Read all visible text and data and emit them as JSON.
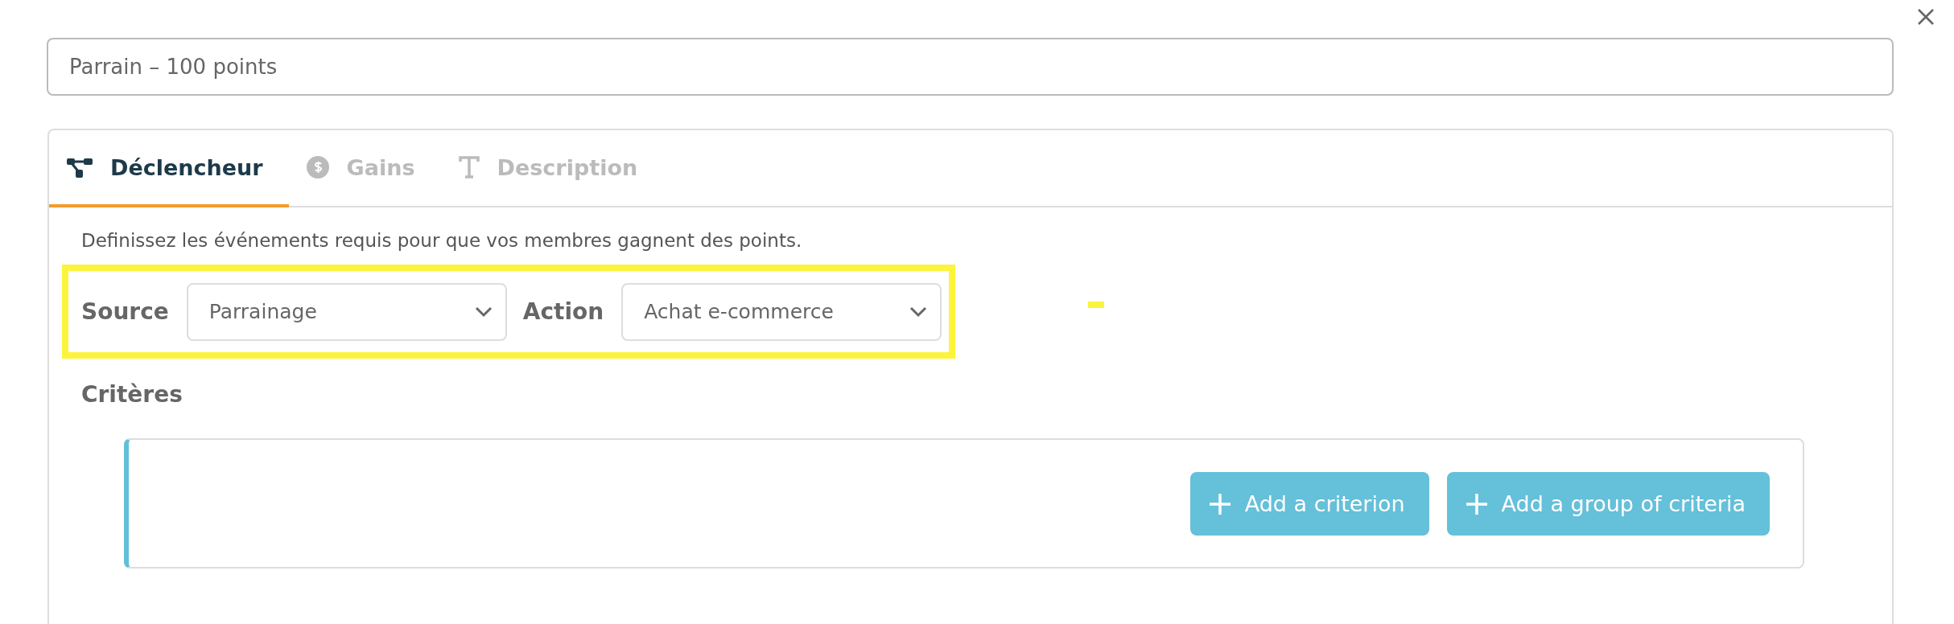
{
  "title_field": {
    "value": "Parrain – 100 points"
  },
  "tabs": [
    {
      "label": "Déclencheur",
      "selected": true
    },
    {
      "label": "Gains",
      "selected": false
    },
    {
      "label": "Description",
      "selected": false
    }
  ],
  "trigger": {
    "intro": "Definissez les événements requis pour que vos membres gagnent des points.",
    "source": {
      "label": "Source",
      "value": "Parrainage"
    },
    "action": {
      "label": "Action",
      "value": "Achat e-commerce"
    }
  },
  "criteria": {
    "title": "Critères",
    "buttons": [
      {
        "label": "Add a criterion"
      },
      {
        "label": "Add a group of criteria"
      }
    ]
  }
}
